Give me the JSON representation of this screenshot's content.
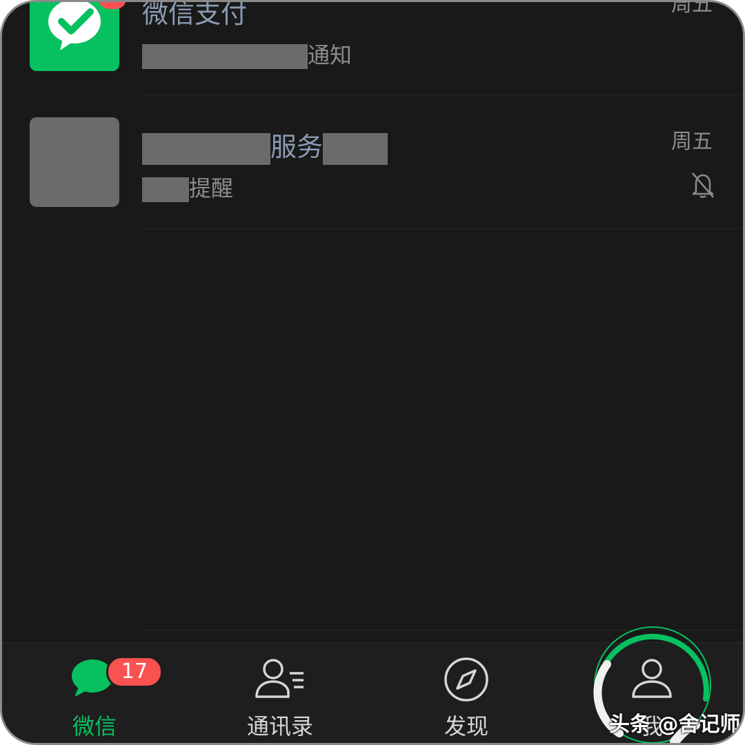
{
  "chats": [
    {
      "name_visible": "微信支付",
      "preview_suffix": "通知",
      "time": "周五",
      "avatar": "wechat-pay-logo-icon",
      "unread_badge": true
    },
    {
      "name_visible": "服务",
      "preview_suffix": "提醒",
      "time": "周五",
      "avatar": "redacted-avatar",
      "muted_icon": "bell-off-icon"
    }
  ],
  "tabbar": {
    "chats_label": "微信",
    "chats_badge": "17",
    "contacts_label": "通讯录",
    "discover_label": "发现",
    "me_label": "我"
  },
  "watermark": "头条 @舍记师",
  "colors": {
    "accent": "#07c160",
    "badge": "#fa5151",
    "background": "#191919"
  }
}
